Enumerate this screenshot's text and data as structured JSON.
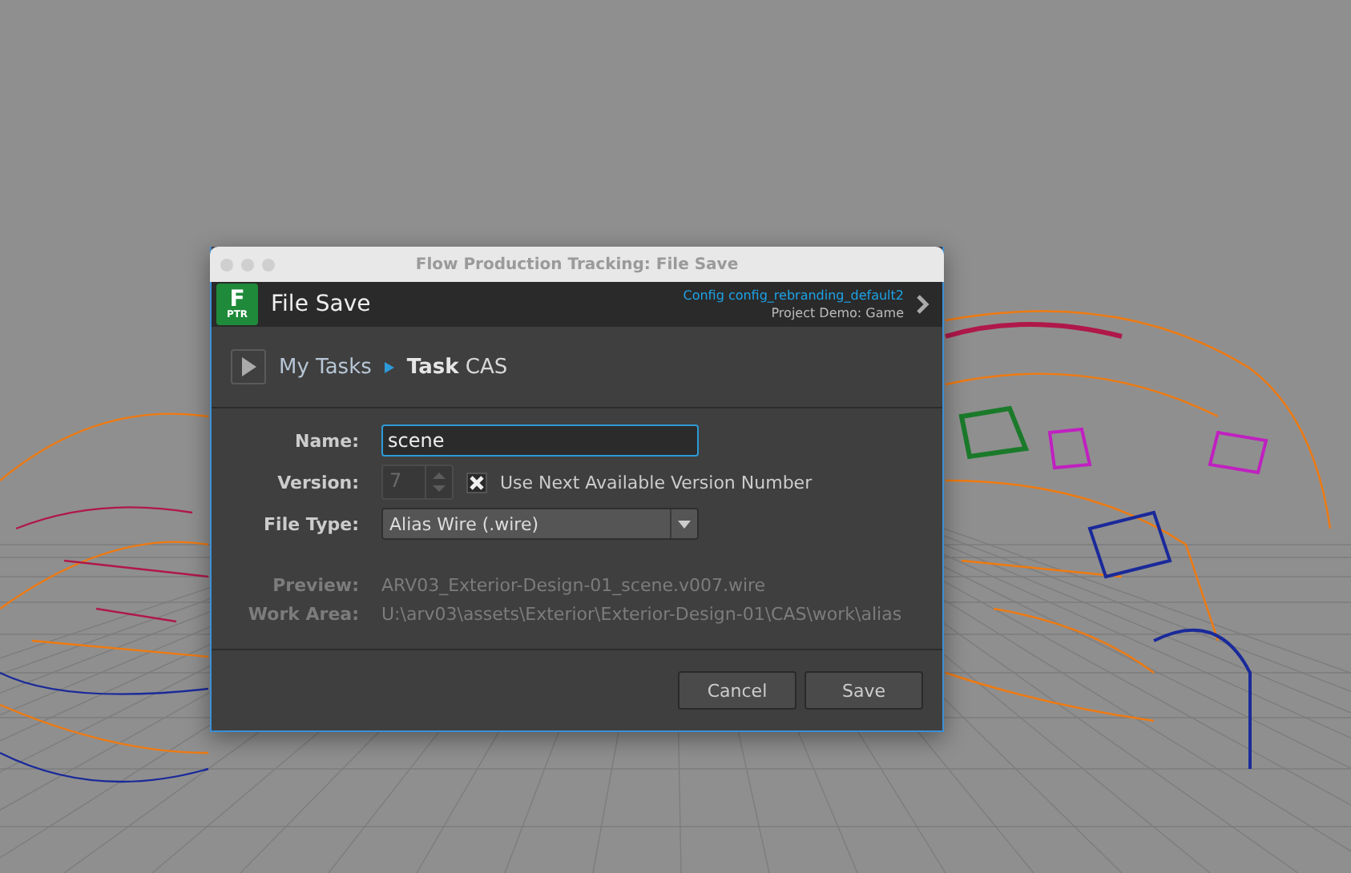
{
  "window": {
    "title": "Flow Production Tracking: File Save"
  },
  "header": {
    "logo_letter": "F",
    "logo_badge": "PTR",
    "title": "File Save",
    "config": "Config config_rebranding_default2",
    "project": "Project Demo: Game"
  },
  "breadcrumb": {
    "root": "My Tasks",
    "current": "**Task** CAS"
  },
  "form": {
    "name_label": "Name:",
    "name_value": "scene",
    "version_label": "Version:",
    "version_value": "7",
    "use_next_label": "Use Next Available Version Number",
    "use_next_checked": true,
    "file_type_label": "File Type:",
    "file_type_value": "Alias Wire (.wire)",
    "preview_label": "Preview:",
    "preview_value": "ARV03_Exterior-Design-01_scene.v007.wire",
    "work_area_label": "Work Area:",
    "work_area_value": "U:\\arv03\\assets\\Exterior\\Exterior-Design-01\\CAS\\work\\alias"
  },
  "buttons": [
    {
      "label": "Cancel"
    },
    {
      "label": "Save"
    }
  ]
}
